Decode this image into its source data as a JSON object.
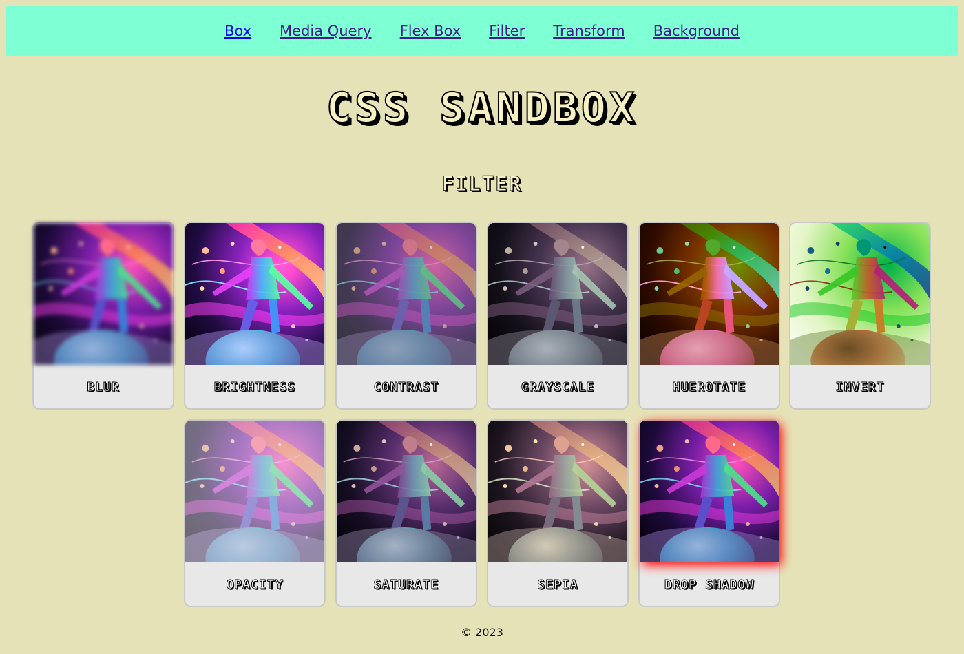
{
  "nav": {
    "links": [
      "Box",
      "Media Query",
      "Flex Box",
      "Filter",
      "Transform",
      "Background"
    ]
  },
  "header": {
    "title": "CSS SANDBOX",
    "subtitle": "FILTER"
  },
  "cards": [
    {
      "label": "BLUR",
      "filter": "blur"
    },
    {
      "label": "BRIGHTNESS",
      "filter": "brightness"
    },
    {
      "label": "CONTRAST",
      "filter": "contrast"
    },
    {
      "label": "GRAYSCALE",
      "filter": "grayscale"
    },
    {
      "label": "HUEROTATE",
      "filter": "hue-rotate"
    },
    {
      "label": "INVERT",
      "filter": "invert"
    },
    {
      "label": "OPACITY",
      "filter": "opacity"
    },
    {
      "label": "SATURATE",
      "filter": "saturate"
    },
    {
      "label": "SEPIA",
      "filter": "sepia"
    },
    {
      "label": "DROP SHADOW",
      "filter": "drop-shadow"
    }
  ],
  "footer": {
    "text": "© 2023"
  },
  "colors": {
    "background": "#e6e2b7",
    "nav_background": "#7fffd4",
    "card_background": "#e8e8e8",
    "drop_shadow": "#ff0000"
  }
}
